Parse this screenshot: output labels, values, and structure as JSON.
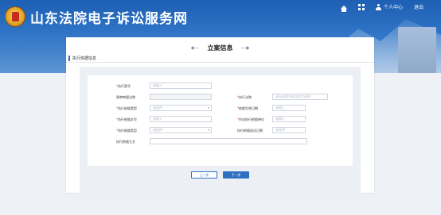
{
  "header": {
    "site_title": "山东法院电子诉讼服务网",
    "nav": {
      "user_center": "个人中心",
      "logout": "退出"
    },
    "tower_text": "五 岳 ..."
  },
  "card": {
    "title": "立案信息",
    "section_title": "执行依据信息"
  },
  "form": {
    "fields": [
      {
        "key": "case_number",
        "label": "执行案号",
        "required": true,
        "placeholder": "请输入",
        "type": "input"
      },
      {
        "key": "original_trial_case",
        "label": "原审审理法院",
        "required": false,
        "placeholder": "",
        "type": "blurred"
      },
      {
        "key": "exec_court",
        "label": "执行法院",
        "required": true,
        "placeholder": "请先选择中级法院后选择",
        "type": "input"
      },
      {
        "key": "exec_basis_type",
        "label": "执行依据类型",
        "required": true,
        "placeholder": "请选择",
        "type": "select"
      },
      {
        "key": "basis_effective_date",
        "label": "依据生效日期",
        "required": true,
        "placeholder": "请输入",
        "type": "input"
      },
      {
        "key": "exec_basis_number",
        "label": "执行依据文号",
        "required": true,
        "placeholder": "请输入",
        "type": "input"
      },
      {
        "key": "basis_issuing_unit",
        "label": "作出执行依据单位",
        "required": true,
        "placeholder": "请输入",
        "type": "input"
      },
      {
        "key": "exec_basis_category",
        "label": "执行依据类型",
        "required": true,
        "placeholder": "请选择",
        "type": "select"
      },
      {
        "key": "basis_delivery_date",
        "label": "执行依据送达日期",
        "required": false,
        "placeholder": "请选择",
        "type": "input"
      },
      {
        "key": "exec_basis_main_text",
        "label": "执行依据主文",
        "required": false,
        "placeholder": "",
        "type": "input"
      }
    ]
  },
  "buttons": {
    "prev": "上一步",
    "next": "下一步"
  }
}
